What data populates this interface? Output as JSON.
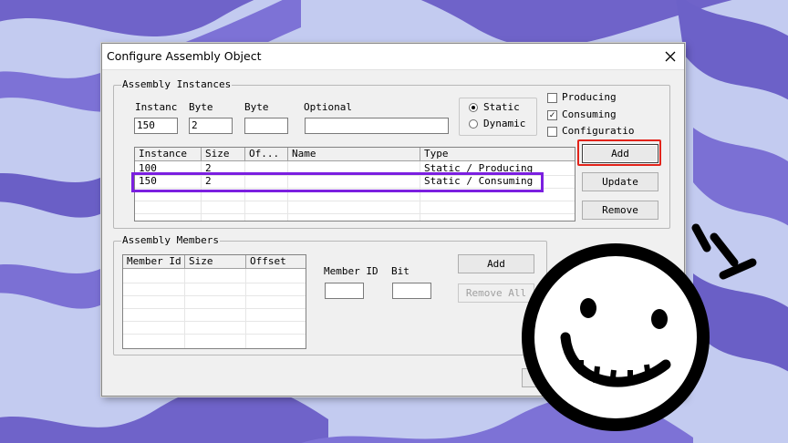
{
  "dialog": {
    "title": "Configure Assembly Object"
  },
  "instances_group": {
    "legend": "Assembly Instances",
    "fields": {
      "instance_label": "Instanc",
      "instance_value": "150",
      "byte1_label": "Byte",
      "byte1_value": "2",
      "byte2_label": "Byte",
      "byte2_value": "",
      "optional_label": "Optional",
      "optional_value": ""
    },
    "type_radio": {
      "static_label": "Static",
      "dynamic_label": "Dynamic",
      "selected": "Static"
    },
    "checkboxes": [
      {
        "label": "Producing",
        "checked": false
      },
      {
        "label": "Consuming",
        "checked": true
      },
      {
        "label": "Configuratio",
        "checked": false
      }
    ],
    "table": {
      "columns": [
        "Instance",
        "Size",
        "Of...",
        "Name",
        "Type"
      ],
      "rows": [
        {
          "instance": "100",
          "size": "2",
          "offset": "",
          "name": "",
          "type": "Static / Producing"
        },
        {
          "instance": "150",
          "size": "2",
          "offset": "",
          "name": "",
          "type": "Static / Consuming"
        }
      ]
    },
    "buttons": {
      "add": "Add",
      "update": "Update",
      "remove": "Remove"
    }
  },
  "members_group": {
    "legend": "Assembly Members",
    "table": {
      "columns": [
        "Member Id",
        "Size",
        "Offset"
      ]
    },
    "member_id_label": "Member ID",
    "member_id_value": "",
    "bit_label": "Bit",
    "bit_value": "",
    "buttons": {
      "add": "Add",
      "remove_all": "Remove All"
    }
  },
  "colors": {
    "highlight_red": "#e2231a",
    "highlight_purple": "#7b1fe0",
    "background_light": "#b9c3ec",
    "background_dark": "#7a6fd0"
  },
  "decorations": {
    "sticker": "smiley-face-sticker"
  }
}
